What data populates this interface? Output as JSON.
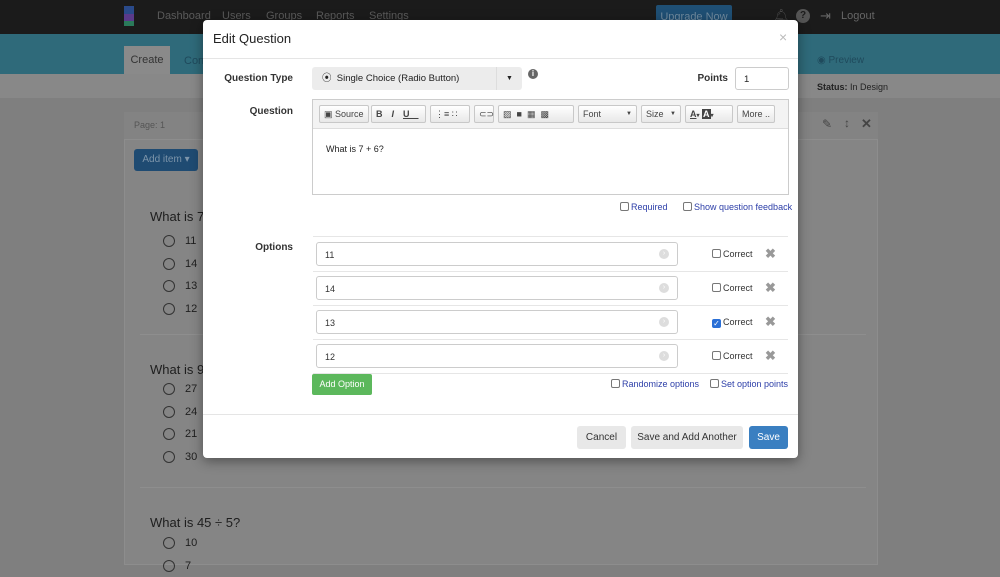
{
  "nav": {
    "items": [
      "Dashboard",
      "Users",
      "Groups",
      "Reports",
      "Settings"
    ],
    "upgrade": "Upgrade Now",
    "logout": "Logout"
  },
  "tabs": {
    "create": "Create",
    "second": "Con",
    "preview": "Preview"
  },
  "status": {
    "label": "Status:",
    "value": "In Design"
  },
  "page": {
    "label": "Page: 1",
    "add_item": "Add item ▾",
    "questions": [
      {
        "text": "What is 7",
        "options": [
          "11",
          "14",
          "13",
          "12"
        ]
      },
      {
        "text": "What is 9",
        "options": [
          "27",
          "24",
          "21",
          "30"
        ]
      },
      {
        "text": "What is 45 ÷ 5?",
        "options": [
          "10",
          "7"
        ]
      }
    ]
  },
  "modal": {
    "title": "Edit Question",
    "close": "×",
    "question_type_label": "Question Type",
    "question_type_value": "Single Choice (Radio Button)",
    "points_label": "Points",
    "points_value": "1",
    "question_label": "Question",
    "toolbar": {
      "source": "Source",
      "bold": "B",
      "italic": "I",
      "underline": "U",
      "font": "Font",
      "size": "Size",
      "text_color": "A",
      "bg_color": "A",
      "more": "More .."
    },
    "question_text": "What is 7 + 6?",
    "required": "Required",
    "show_feedback": "Show question feedback",
    "options_label": "Options",
    "options": [
      {
        "value": "11",
        "correct": false
      },
      {
        "value": "14",
        "correct": false
      },
      {
        "value": "13",
        "correct": true
      },
      {
        "value": "12",
        "correct": false
      }
    ],
    "correct_label": "Correct",
    "add_option": "Add Option",
    "randomize": "Randomize options",
    "set_points": "Set option points",
    "cancel": "Cancel",
    "save_add": "Save and Add Another",
    "save": "Save"
  },
  "colors": {
    "accent": "#3a7fc1",
    "add_option": "#5cb85c",
    "link": "#2c3ea8"
  }
}
